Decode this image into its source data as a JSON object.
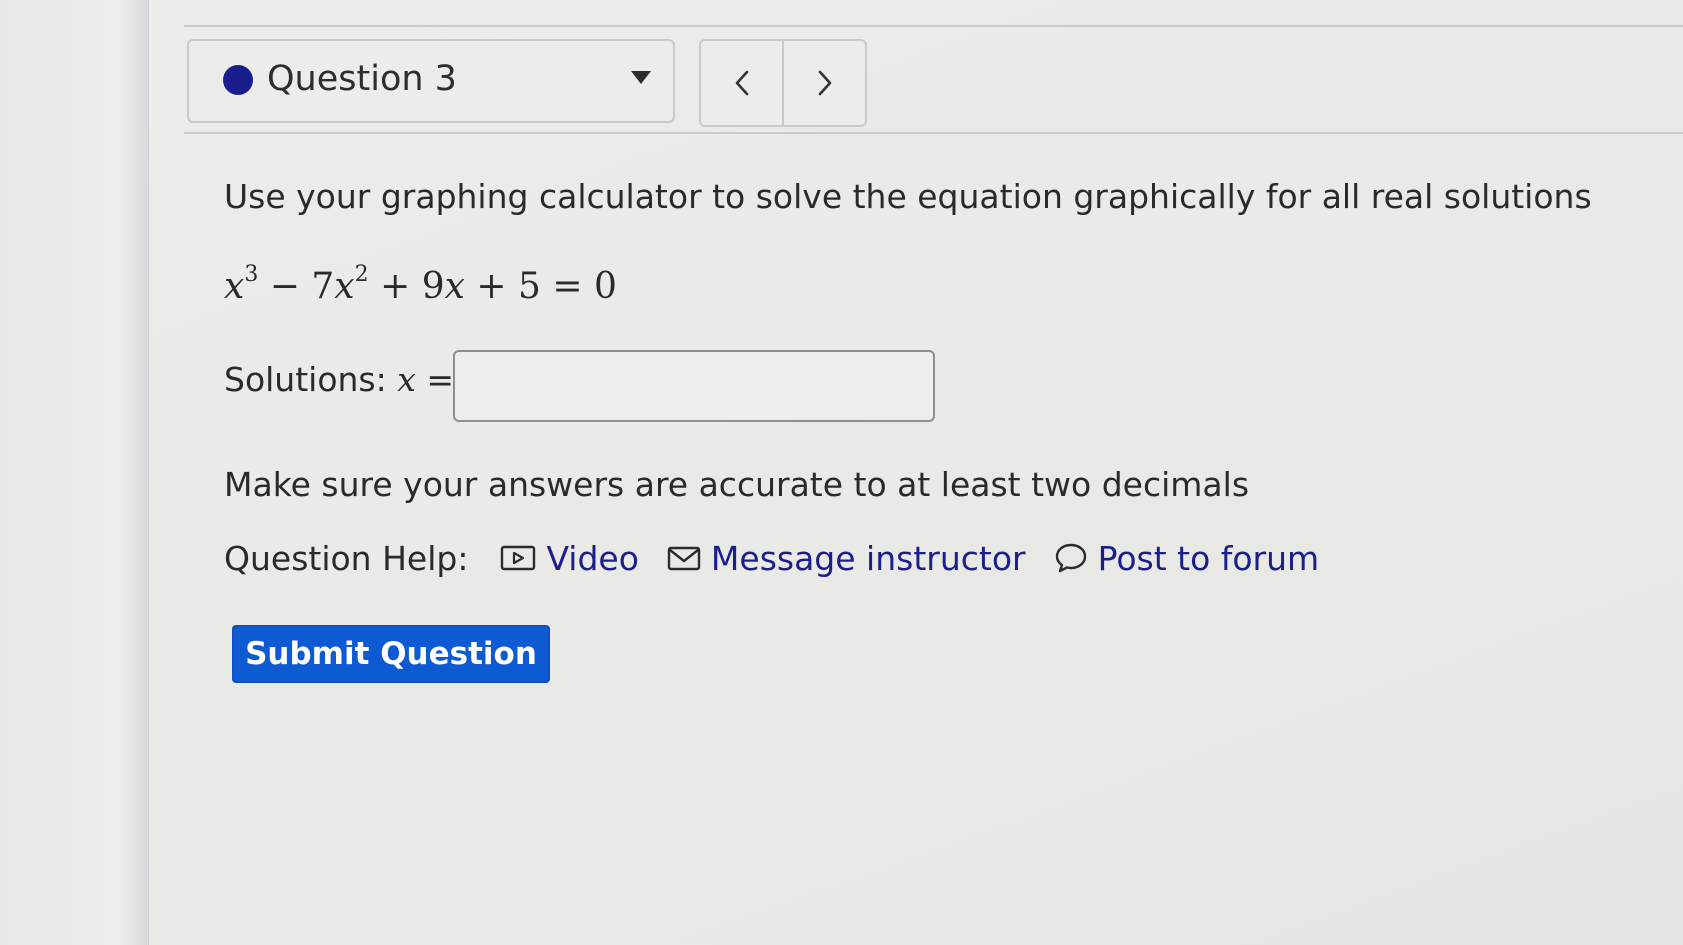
{
  "question_selector": {
    "label": "Question 3",
    "status_color": "#1a1e8c"
  },
  "navigation": {
    "prev_icon": "chevron-left-icon",
    "next_icon": "chevron-right-icon"
  },
  "question": {
    "prompt": "Use your graphing calculator to solve the equation graphically for all real solutions",
    "equation": {
      "t1_base": "x",
      "t1_exp": "3",
      "op1": "−",
      "t2_coef": "7",
      "t2_base": "x",
      "t2_exp": "2",
      "op2": "+",
      "t3_coef": "9",
      "t3_base": "x",
      "op3": "+",
      "constant": "5",
      "equals": "=",
      "rhs": "0"
    },
    "solutions_label": "Solutions:",
    "solutions_var": "x",
    "solutions_equals": "=",
    "answer_value": "",
    "accuracy_note": "Make sure your answers are accurate to at least two decimals"
  },
  "help": {
    "label": "Question Help:",
    "links": [
      {
        "label": "Video",
        "icon": "video-play-icon"
      },
      {
        "label": "Message instructor",
        "icon": "envelope-icon"
      },
      {
        "label": "Post to forum",
        "icon": "speech-bubble-icon"
      }
    ],
    "link_color": "#1b1f8a"
  },
  "submit": {
    "label": "Submit Question",
    "color": "#0d5ad3"
  }
}
